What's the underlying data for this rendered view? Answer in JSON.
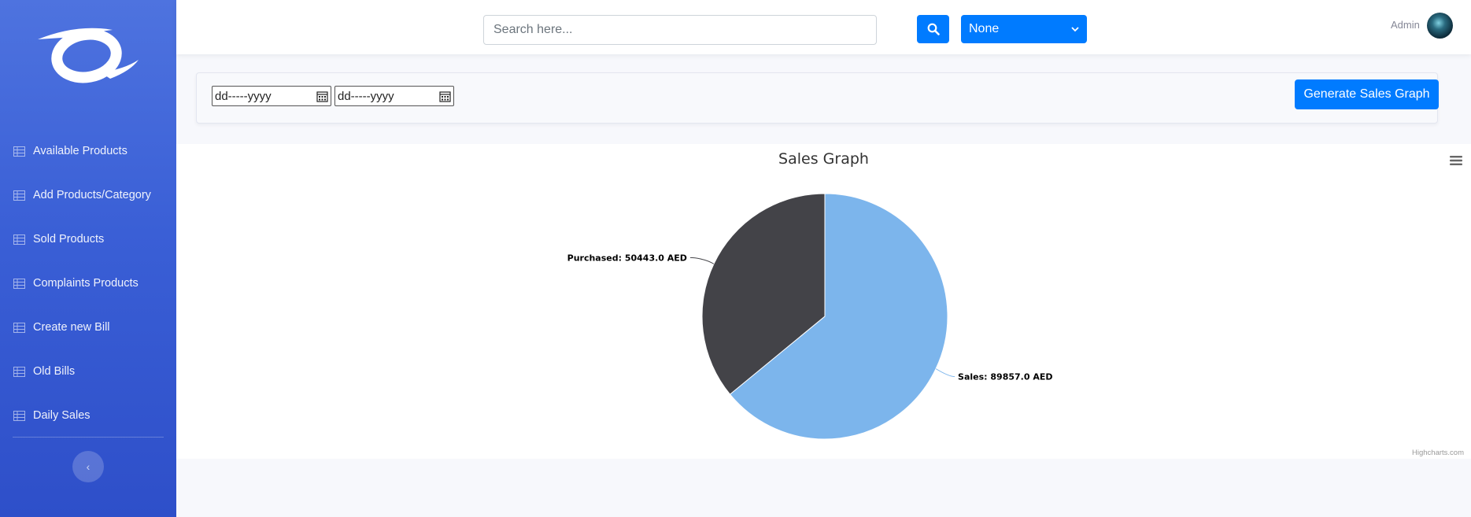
{
  "sidebar": {
    "items": [
      {
        "label": "Available Products",
        "icon": "table-icon"
      },
      {
        "label": "Add Products/Category",
        "icon": "table-icon"
      },
      {
        "label": "Sold Products",
        "icon": "table-icon"
      },
      {
        "label": "Complaints Products",
        "icon": "table-icon"
      },
      {
        "label": "Create new Bill",
        "icon": "table-icon"
      },
      {
        "label": "Old Bills",
        "icon": "table-icon"
      },
      {
        "label": "Daily Sales",
        "icon": "table-icon"
      }
    ],
    "toggle_icon": "‹"
  },
  "topbar": {
    "search_placeholder": "Search here...",
    "select_value": "None",
    "user_name": "Admin"
  },
  "filter": {
    "date_from_placeholder": "dd-----yyyy",
    "date_to_placeholder": "dd-----yyyy",
    "generate_label": "Generate Sales Graph"
  },
  "chart_data": {
    "type": "pie",
    "title": "Sales Graph",
    "series": [
      {
        "name": "Sales",
        "value": 89857.0,
        "label": "Sales: 89857.0 AED",
        "color": "#7cb5ec"
      },
      {
        "name": "Purchased",
        "value": 50443.0,
        "label": "Purchased: 50443.0 AED",
        "color": "#434348"
      }
    ],
    "credit": "Highcharts.com"
  },
  "colors": {
    "primary": "#007bff",
    "sidebar": "#4e73df"
  }
}
